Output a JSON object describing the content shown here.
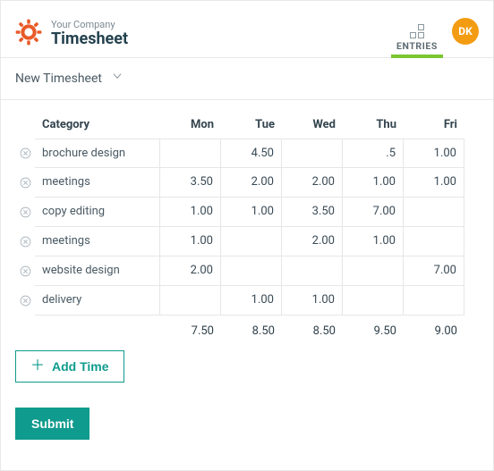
{
  "header": {
    "company": "Your Company",
    "page_title": "Timesheet",
    "nav_entries_label": "ENTRIES",
    "avatar_initials": "DK"
  },
  "subheader": {
    "title": "New Timesheet"
  },
  "columns": {
    "category": "Category",
    "d0": "Mon",
    "d1": "Tue",
    "d2": "Wed",
    "d3": "Thu",
    "d4": "Fri"
  },
  "rows": [
    {
      "category": "brochure design",
      "d0": "",
      "d1": "4.50",
      "d2": "",
      "d3": ".5",
      "d4": "1.00"
    },
    {
      "category": "meetings",
      "d0": "3.50",
      "d1": "2.00",
      "d2": "2.00",
      "d3": "1.00",
      "d4": "1.00"
    },
    {
      "category": "copy editing",
      "d0": "1.00",
      "d1": "1.00",
      "d2": "3.50",
      "d3": "7.00",
      "d4": ""
    },
    {
      "category": "meetings",
      "d0": "1.00",
      "d1": "",
      "d2": "2.00",
      "d3": "1.00",
      "d4": ""
    },
    {
      "category": "website design",
      "d0": "2.00",
      "d1": "",
      "d2": "",
      "d3": "",
      "d4": "7.00"
    },
    {
      "category": "delivery",
      "d0": "",
      "d1": "1.00",
      "d2": "1.00",
      "d3": "",
      "d4": ""
    }
  ],
  "totals": {
    "d0": "7.50",
    "d1": "8.50",
    "d2": "8.50",
    "d3": "9.50",
    "d4": "9.00"
  },
  "buttons": {
    "add_time": "Add Time",
    "submit": "Submit"
  }
}
